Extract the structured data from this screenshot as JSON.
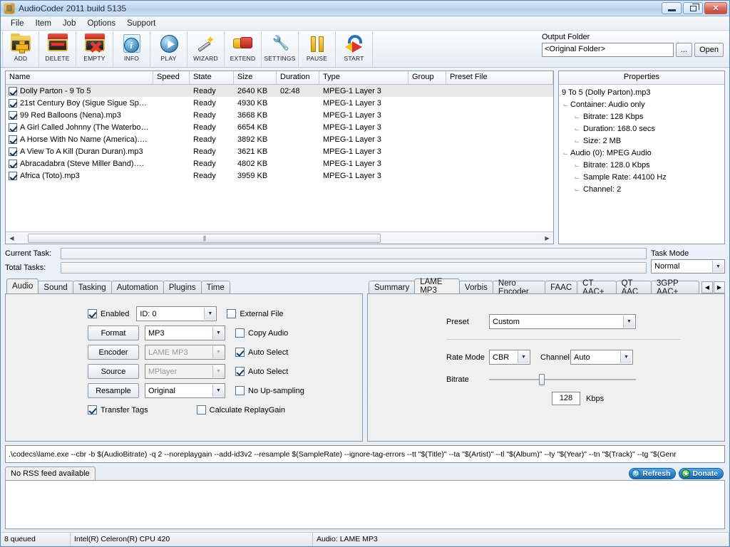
{
  "window": {
    "title": "AudioCoder 2011 build 5135",
    "minimize_label": "Minimize",
    "restore_label": "Restore",
    "close_label": "✕"
  },
  "menubar": {
    "items": [
      "File",
      "Item",
      "Job",
      "Options",
      "Support"
    ]
  },
  "toolbar": {
    "buttons": [
      {
        "label": "ADD",
        "icon": "add-folder-icon"
      },
      {
        "label": "DELETE",
        "icon": "delete-folder-icon"
      },
      {
        "label": "EMPTY",
        "icon": "empty-folder-icon"
      },
      {
        "label": "INFO",
        "icon": "info-icon"
      },
      {
        "label": "PLAY",
        "icon": "play-icon"
      },
      {
        "label": "WIZARD",
        "icon": "wand-icon"
      },
      {
        "label": "EXTEND",
        "icon": "extend-icon"
      },
      {
        "label": "SETTINGS",
        "icon": "wrench-icon"
      },
      {
        "label": "PAUSE",
        "icon": "pause-icon"
      },
      {
        "label": "START",
        "icon": "start-arrow-icon"
      }
    ]
  },
  "output_folder": {
    "label": "Output Folder",
    "value": "<Original Folder>",
    "browse_label": "...",
    "open_label": "Open"
  },
  "file_list": {
    "columns": [
      "Name",
      "Speed",
      "State",
      "Size",
      "Duration",
      "Type",
      "Group",
      "Preset File"
    ],
    "rows": [
      {
        "checked": true,
        "name": "Dolly Parton - 9 To 5",
        "speed": "",
        "state": "Ready",
        "size": "2640 KB",
        "duration": "02:48",
        "type": "MPEG-1 Layer 3",
        "group": "",
        "preset": "",
        "selected": true
      },
      {
        "checked": true,
        "name": "21st Century Boy (Sigue Sigue Sp…",
        "speed": "",
        "state": "Ready",
        "size": "4930 KB",
        "duration": "",
        "type": "MPEG-1 Layer 3",
        "group": "",
        "preset": "",
        "selected": false
      },
      {
        "checked": true,
        "name": "99 Red Balloons (Nena).mp3",
        "speed": "",
        "state": "Ready",
        "size": "3668 KB",
        "duration": "",
        "type": "MPEG-1 Layer 3",
        "group": "",
        "preset": "",
        "selected": false
      },
      {
        "checked": true,
        "name": "A Girl Called Johnny (The Waterbo…",
        "speed": "",
        "state": "Ready",
        "size": "6654 KB",
        "duration": "",
        "type": "MPEG-1 Layer 3",
        "group": "",
        "preset": "",
        "selected": false
      },
      {
        "checked": true,
        "name": "A Horse With No Name (America)….",
        "speed": "",
        "state": "Ready",
        "size": "3892 KB",
        "duration": "",
        "type": "MPEG-1 Layer 3",
        "group": "",
        "preset": "",
        "selected": false
      },
      {
        "checked": true,
        "name": "A View To A Kill (Duran Duran).mp3",
        "speed": "",
        "state": "Ready",
        "size": "3621 KB",
        "duration": "",
        "type": "MPEG-1 Layer 3",
        "group": "",
        "preset": "",
        "selected": false
      },
      {
        "checked": true,
        "name": "Abracadabra (Steve Miller Band)….",
        "speed": "",
        "state": "Ready",
        "size": "4802 KB",
        "duration": "",
        "type": "MPEG-1 Layer 3",
        "group": "",
        "preset": "",
        "selected": false
      },
      {
        "checked": true,
        "name": "Africa (Toto).mp3",
        "speed": "",
        "state": "Ready",
        "size": "3959 KB",
        "duration": "",
        "type": "MPEG-1 Layer 3",
        "group": "",
        "preset": "",
        "selected": false
      }
    ]
  },
  "properties": {
    "header": "Properties",
    "root": "9 To 5 (Dolly Parton).mp3",
    "nodes": [
      {
        "level": 1,
        "text": "Container: Audio only"
      },
      {
        "level": 2,
        "text": "Bitrate: 128 Kbps"
      },
      {
        "level": 2,
        "text": "Duration: 168.0 secs"
      },
      {
        "level": 2,
        "text": "Size: 2 MB"
      },
      {
        "level": 1,
        "text": "Audio (0): MPEG Audio"
      },
      {
        "level": 2,
        "text": "Bitrate: 128.0 Kbps"
      },
      {
        "level": 2,
        "text": "Sample Rate: 44100 Hz"
      },
      {
        "level": 2,
        "text": "Channel: 2"
      }
    ]
  },
  "tasks": {
    "current_label": "Current Task:",
    "total_label": "Total Tasks:",
    "current_progress": 0,
    "total_progress": 0,
    "task_mode_label": "Task Mode",
    "task_mode_value": "Normal"
  },
  "left_tabs": {
    "items": [
      "Audio",
      "Sound",
      "Tasking",
      "Automation",
      "Plugins",
      "Time"
    ],
    "active": "Audio"
  },
  "audio_panel": {
    "enabled_label": "Enabled",
    "enabled_checked": true,
    "id_value": "ID: 0",
    "external_file_label": "External File",
    "external_file_checked": false,
    "format_button": "Format",
    "format_value": "MP3",
    "copy_audio_label": "Copy Audio",
    "copy_audio_checked": false,
    "encoder_button": "Encoder",
    "encoder_value": "LAME MP3",
    "encoder_auto_label": "Auto Select",
    "encoder_auto_checked": true,
    "source_button": "Source",
    "source_value": "MPlayer",
    "source_auto_label": "Auto Select",
    "source_auto_checked": true,
    "resample_button": "Resample",
    "resample_value": "Original",
    "no_upsampling_label": "No Up-sampling",
    "no_upsampling_checked": false,
    "transfer_tags_label": "Transfer Tags",
    "transfer_tags_checked": true,
    "replaygain_label": "Calculate ReplayGain",
    "replaygain_checked": false
  },
  "right_tabs": {
    "items": [
      "Summary",
      "LAME MP3",
      "Vorbis",
      "Nero Encoder",
      "FAAC",
      "CT AAC+",
      "QT AAC",
      "3GPP AAC+"
    ],
    "active": "LAME MP3",
    "prev_label": "◀",
    "next_label": "▶"
  },
  "lame_panel": {
    "preset_label": "Preset",
    "preset_value": "Custom",
    "rate_mode_label": "Rate Mode",
    "rate_mode_value": "CBR",
    "channel_label": "Channel",
    "channel_value": "Auto",
    "bitrate_label": "Bitrate",
    "bitrate_value": "128",
    "bitrate_unit": "Kbps",
    "bitrate_slider_percent": 34
  },
  "command_line": {
    "value": ".\\codecs\\lame.exe --cbr -b $(AudioBitrate) -q 2 --noreplaygain --add-id3v2 --resample $(SampleRate) --ignore-tag-errors --tt \"$(Title)\" --ta \"$(Artist)\" --tl \"$(Album)\" --ty \"$(Year)\" --tn \"$(Track)\" --tg \"$(Genr"
  },
  "rss": {
    "tab_label": "No RSS feed available",
    "refresh_label": "Refresh",
    "donate_label": "Donate",
    "refresh_icon": "refresh-circle-icon",
    "donate_icon": "star-circle-icon"
  },
  "statusbar": {
    "queued": "8 queued",
    "cpu": "Intel(R) Celeron(R) CPU 420",
    "audio": "Audio: LAME MP3"
  }
}
